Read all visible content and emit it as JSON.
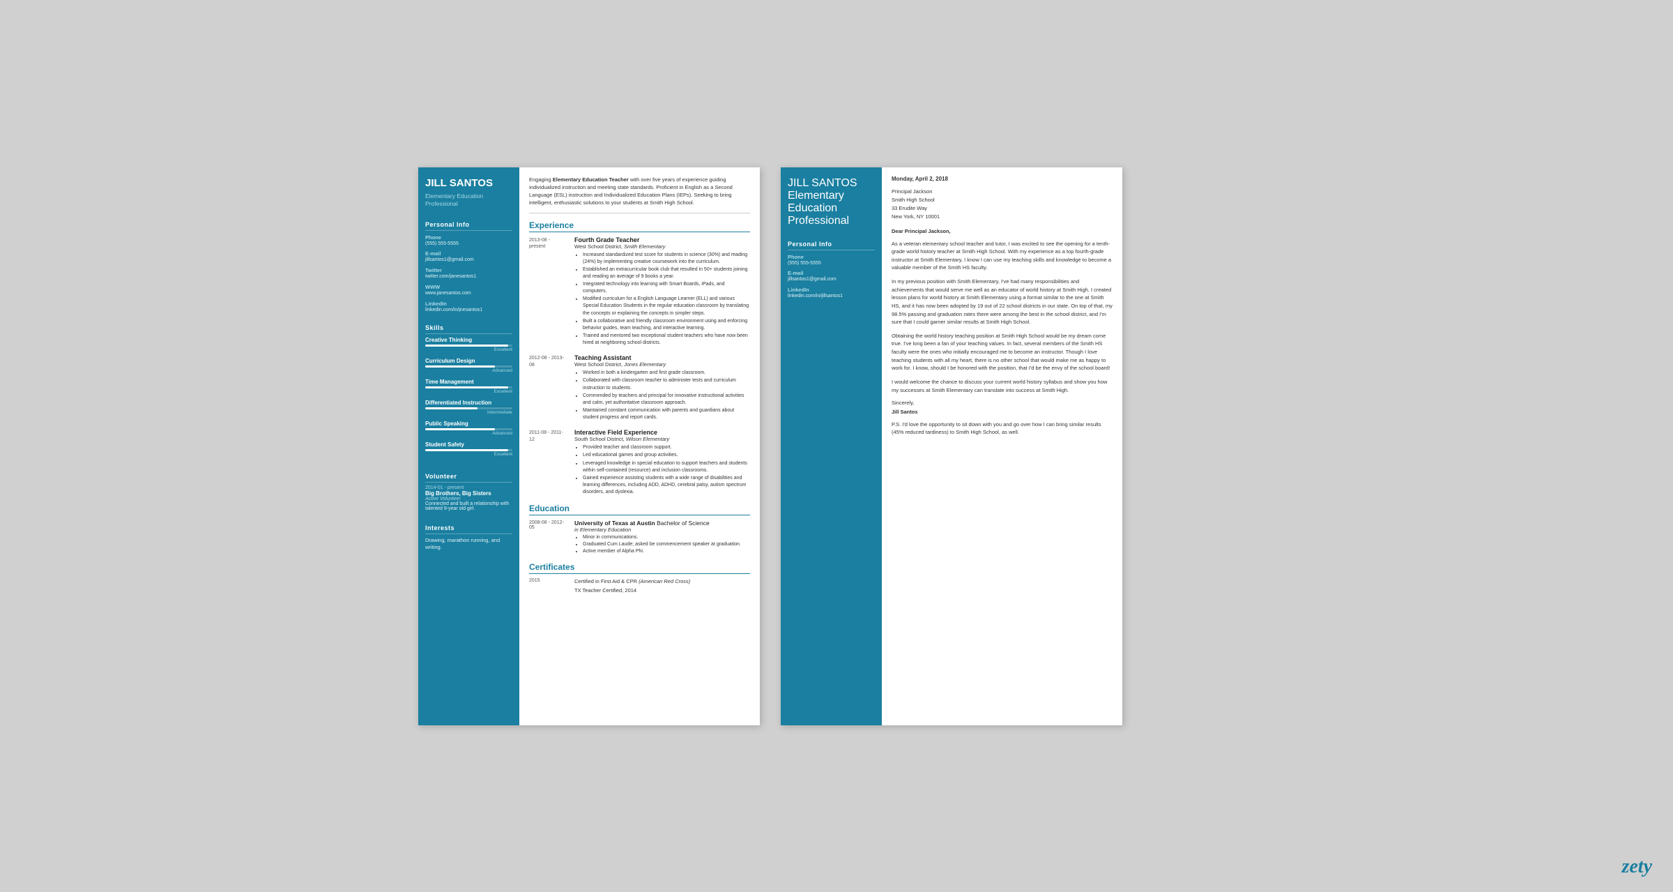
{
  "resume": {
    "sidebar": {
      "name": "JILL SANTOS",
      "title": "Elementary Education Professional",
      "personal_info_label": "Personal Info",
      "phone_label": "Phone",
      "phone": "(555) 555-5555",
      "email_label": "E-mail",
      "email": "jillsantos1@gmail.com",
      "twitter_label": "Twitter",
      "twitter": "twitter.com/janesantos1",
      "www_label": "WWW",
      "www": "www.janesantos.com",
      "linkedin_label": "LinkedIn",
      "linkedin": "linkedin.com/in/jnesantos1",
      "skills_label": "Skills",
      "skills": [
        {
          "name": "Creative Thinking",
          "level": "Excellent",
          "pct": 95
        },
        {
          "name": "Curriculum Design",
          "level": "Advanced",
          "pct": 80
        },
        {
          "name": "Time Management",
          "level": "Excellent",
          "pct": 95
        },
        {
          "name": "Differentiated Instruction",
          "level": "Intermediate",
          "pct": 60
        },
        {
          "name": "Public Speaking",
          "level": "Advanced",
          "pct": 80
        },
        {
          "name": "Student Safety",
          "level": "Excellent",
          "pct": 95
        }
      ],
      "volunteer_label": "Volunteer",
      "volunteer_date": "2014-01 - present",
      "volunteer_org": "Big Brothers, Big Sisters",
      "volunteer_role": "Active Volunteer",
      "volunteer_desc": "Connected and built a relationship with talented 9-year old girl.",
      "interests_label": "Interests",
      "interests": "Drawing, marathon running, and writing."
    },
    "summary": "Engaging Elementary Education Teacher with over five years of experience guiding individualized instruction and meeting state standards. Proficient in English as a Second Language (ESL) instruction and Individualized Education Plans (IEPs). Seeking to bring intelligent, enthusiastic solutions to your students at Smith High School.",
    "experience_label": "Experience",
    "experience": [
      {
        "date": "2013-08 - present",
        "title": "Fourth Grade Teacher",
        "company": "West School District,",
        "company_em": "Smith Elementary",
        "bullets": [
          "Increased standardized test score for students in science (30%) and reading (24%) by implementing creative coursework into the curriculum.",
          "Established an extracurricular book club that resulted in 50+ students joining and reading an average of 9 books a year.",
          "Integrated technology into learning with Smart Boards, iPads, and computers.",
          "Modified curriculum for a English Language Learner (ELL) and various Special Education Students in the regular education classroom by translating the concepts or explaining the concepts in simpler steps.",
          "Built a collaborative and friendly classroom environment using and enforcing behavior guides, team teaching, and interactive learning.",
          "Trained and mentored two exceptional student teachers who have now been hired at neighboring school districts."
        ]
      },
      {
        "date": "2012-08 - 2013-08",
        "title": "Teaching Assistant",
        "company": "West School District,",
        "company_em": "Jones Elementary",
        "bullets": [
          "Worked in both a kindergarten and first grade classroom.",
          "Collaborated with classroom teacher to administer tests and curriculum instruction to students.",
          "Commended by teachers and principal for innovative instructional activities and calm, yet authoritative classroom approach.",
          "Maintained constant communication with parents and guardians about student progress and report cards."
        ]
      },
      {
        "date": "2011-08 - 2011-12",
        "title": "Interactive Field Experience",
        "company": "South School District,",
        "company_em": "Wilson Elementary",
        "bullets": [
          "Provided teacher and classroom support.",
          "Led educational games and group activities.",
          "Leveraged knowledge in special education to support teachers and students within self-contained (resource) and inclusion classrooms.",
          "Gained experience assisting students with a wide range of disabilities and learning differences, including ADD, ADHD, cerebral palsy, autism spectrum disorders, and dyslexia."
        ]
      }
    ],
    "education_label": "Education",
    "education": [
      {
        "date": "2008-08 - 2012-05",
        "school": "University of Texas at Austin",
        "degree_pre": "Bachelor of Science",
        "degree_em": "in Elementary Education",
        "bullets": [
          "Minor in communications.",
          "Graduated Cum Laude; asked be commencement speaker at graduation.",
          "Active member of Alpha Phi."
        ]
      }
    ],
    "certificates_label": "Certificates",
    "certificates": [
      {
        "year": "2015",
        "text": "Certified in First Aid & CPR",
        "em": "(American Red Cross)"
      },
      {
        "year": "",
        "text": "TX Teacher Certified, 2014",
        "em": ""
      }
    ]
  },
  "cover_letter": {
    "sidebar": {
      "name": "JILL SANTOS",
      "title": "Elementary Education Professional",
      "personal_info_label": "Personal Info",
      "phone_label": "Phone",
      "phone": "(555) 555-5555",
      "email_label": "E-mail",
      "email": "jillsantos1@gmail.com",
      "linkedin_label": "LinkedIn",
      "linkedin": "linkedin.com/in/jillsantos1"
    },
    "date": "Monday, April 2, 2018",
    "recipient_lines": [
      "Principal Jackson",
      "Smith High School",
      "33 Erudite Way",
      "New York, NY 10001"
    ],
    "greeting": "Dear Principal Jackson,",
    "paragraphs": [
      "As a veteran elementary school teacher and tutor, I was excited to see the opening for a tenth-grade world history teacher at Smith High School. With my experience as a top fourth-grade instructor at Smith Elementary, I know I can use my teaching skills and knowledge to become a valuable member of the Smith HS faculty.",
      "In my previous position with Smith Elementary, I've had many responsibilities and achievements that would serve me well as an educator of world history at Smith High. I created lesson plans for world history at Smith Elementary using a format similar to the one at Smith HS, and it has now been adopted by 19 out of 22 school districts in our state. On top of that, my 98.5% passing and graduation rates there were among the best in the school district, and I'm sure that I could garner similar results at Smith High School.",
      "Obtaining the world history teaching position at Smith High School would be my dream come true. I've long been a fan of your teaching values. In fact, several members of the Smith HS faculty were the ones who initially encouraged me to become an instructor. Though I love teaching students with all my heart, there is no other school that would make me as happy to work for. I know, should I be honored with the position, that I'd be the envy of the school board!",
      "I would welcome the chance to discuss your current world history syllabus and show you how my successes at Smith Elementary can translate into success at Smith High."
    ],
    "closing": "Sincerely,",
    "signature": "Jill Santos",
    "ps": "P.S. I'd love the opportunity to sit down with you and go over how I can bring similar results (45% reduced tardiness) to Smith High School, as well."
  },
  "zety_label": "zety"
}
